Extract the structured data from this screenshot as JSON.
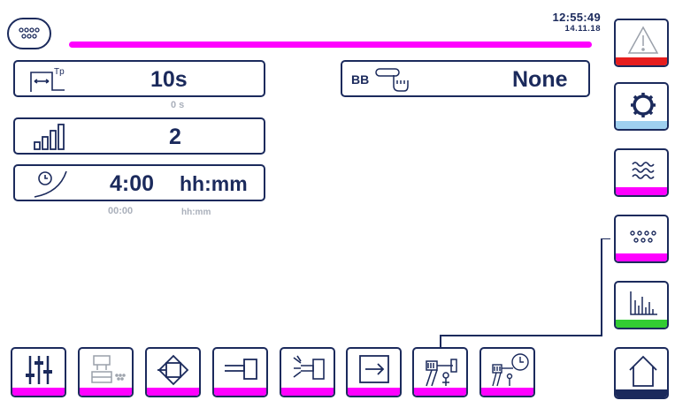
{
  "header": {
    "time": "12:55:49",
    "date": "14.11.18",
    "progress_color": "#ff00ff",
    "menu_icon": "dots-grid-icon"
  },
  "fields": {
    "pulse_time": {
      "icon": "pulse-width-icon",
      "value": "10s",
      "sub_value": "0 s"
    },
    "level": {
      "icon": "signal-bars-icon",
      "value": "2"
    },
    "duration": {
      "icon": "timer-ramp-icon",
      "value": "4:00",
      "unit": "hh:mm",
      "sub_value": "00:00",
      "sub_unit": "hh:mm"
    },
    "bb": {
      "label": "BB",
      "icon": "touch-switch-icon",
      "value": "None"
    }
  },
  "sidebar": [
    {
      "icon": "warning-icon",
      "stripe": "#e61e1e"
    },
    {
      "icon": "gear-icon",
      "stripe": "#9fd0f0"
    },
    {
      "icon": "waves-icon",
      "stripe": "#ff00ff"
    },
    {
      "icon": "dots-grid-icon",
      "stripe": "#ff00ff"
    },
    {
      "icon": "bar-chart-icon",
      "stripe": "#33cc33"
    },
    {
      "icon": "home-icon",
      "stripe": "#1b2a5c"
    }
  ],
  "toolbar": [
    {
      "icon": "sliders-icon"
    },
    {
      "icon": "valve-dots-icon"
    },
    {
      "icon": "diamond-flow-icon"
    },
    {
      "icon": "piston-icon"
    },
    {
      "icon": "sensor-light-icon"
    },
    {
      "icon": "arrow-right-box-icon"
    },
    {
      "icon": "pipe-valve-icon"
    },
    {
      "icon": "pipe-valve-clock-icon"
    }
  ]
}
